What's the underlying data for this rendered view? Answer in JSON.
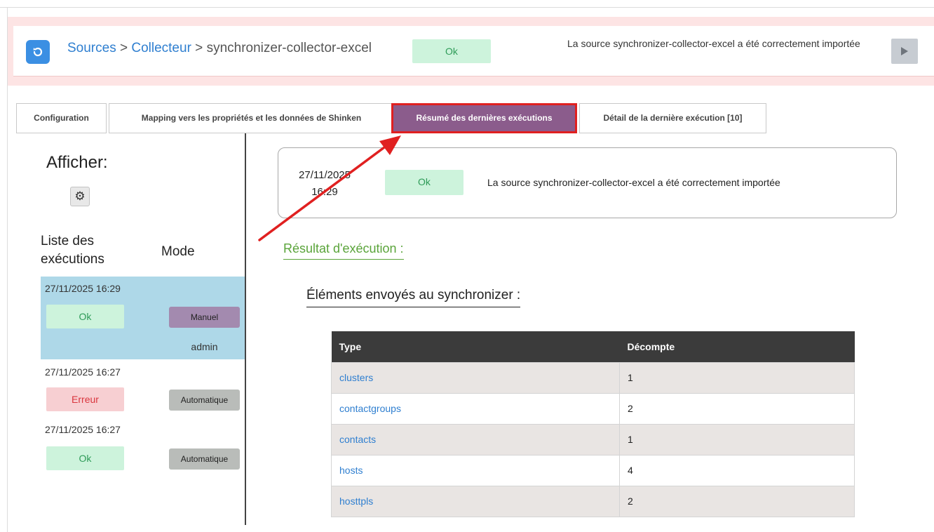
{
  "header": {
    "breadcrumb": {
      "sources": "Sources",
      "sep1": " > ",
      "collecteur": "Collecteur",
      "sep2": " > ",
      "current": "synchronizer-collector-excel"
    },
    "status": "Ok",
    "message": "La source synchronizer-collector-excel a été correctement importée"
  },
  "tabs": [
    {
      "label": "Configuration"
    },
    {
      "label": "Mapping vers les propriétés et les données de Shinken"
    },
    {
      "label": "Résumé des dernières exécutions"
    },
    {
      "label": "Détail de la dernière exécution [10]"
    }
  ],
  "sidebar": {
    "afficher": "Afficher:",
    "col_liste": "Liste des exécutions",
    "col_mode": "Mode",
    "executions": [
      {
        "date": "27/11/2025 16:29",
        "status": "Ok",
        "mode": "Manuel",
        "user": "admin"
      },
      {
        "date": "27/11/2025 16:27",
        "status": "Erreur",
        "mode": "Automatique"
      },
      {
        "date": "27/11/2025 16:27",
        "status": "Ok",
        "mode": "Automatique"
      }
    ]
  },
  "summary": {
    "date": "27/11/2025",
    "time": "16:29",
    "status": "Ok",
    "message": "La source synchronizer-collector-excel a été correctement importée"
  },
  "result": {
    "title": "Résultat d'exécution :",
    "sent_title": "Éléments envoyés au synchronizer :",
    "table": {
      "headers": [
        "Type",
        "Décompte"
      ],
      "rows": [
        {
          "type": "clusters",
          "count": "1"
        },
        {
          "type": "contactgroups",
          "count": "2"
        },
        {
          "type": "contacts",
          "count": "1"
        },
        {
          "type": "hosts",
          "count": "4"
        },
        {
          "type": "hosttpls",
          "count": "2"
        }
      ]
    }
  },
  "colors": {
    "accent": "#3b8fe3",
    "active_tab": "#8b5c8c",
    "ok_bg": "#cdf3dc",
    "error_bg": "#f7cfd2",
    "annotation": "#e02020",
    "result_green": "#5aa43a"
  }
}
